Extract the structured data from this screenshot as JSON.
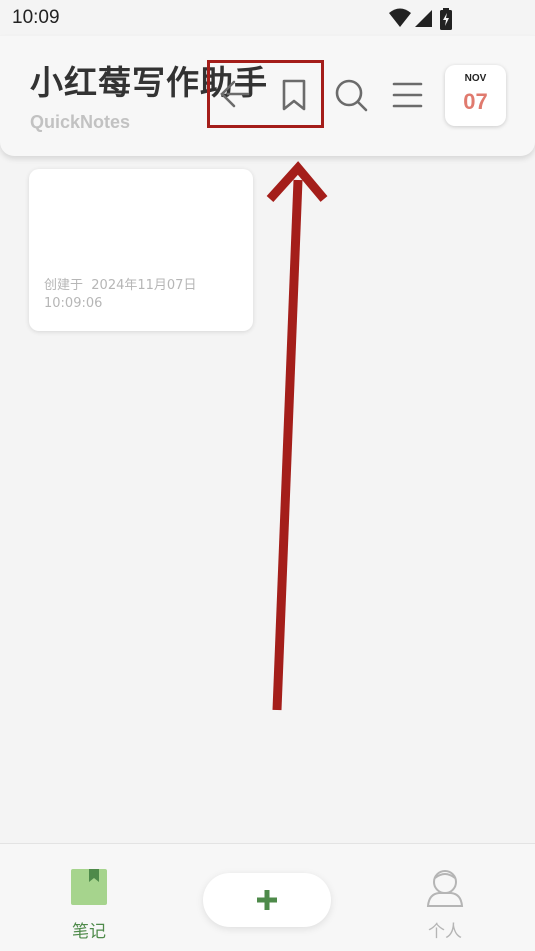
{
  "status_bar": {
    "time": "10:09",
    "icons": [
      "wifi-icon",
      "signal-icon",
      "battery-charging-icon"
    ]
  },
  "header": {
    "title": "小红莓写作助手",
    "subtitle": "QuickNotes",
    "actions": [
      "back-icon",
      "bookmark-icon",
      "search-icon",
      "menu-icon"
    ],
    "date_badge": {
      "month": "NOV",
      "day": "07"
    }
  },
  "notes": [
    {
      "created_label": "创建于",
      "created_at": "2024年11月07日 10:09:06"
    }
  ],
  "bottom_nav": {
    "notes_label": "笔记",
    "profile_label": "个人",
    "add_icon": "plus-icon"
  },
  "colors": {
    "accent_green": "#4e8a4a",
    "nav_active_icon": "#a6d48d",
    "date_day": "#e07a6e",
    "annotation_red": "#a41e1a",
    "inactive_gray": "#b5b5b5"
  }
}
